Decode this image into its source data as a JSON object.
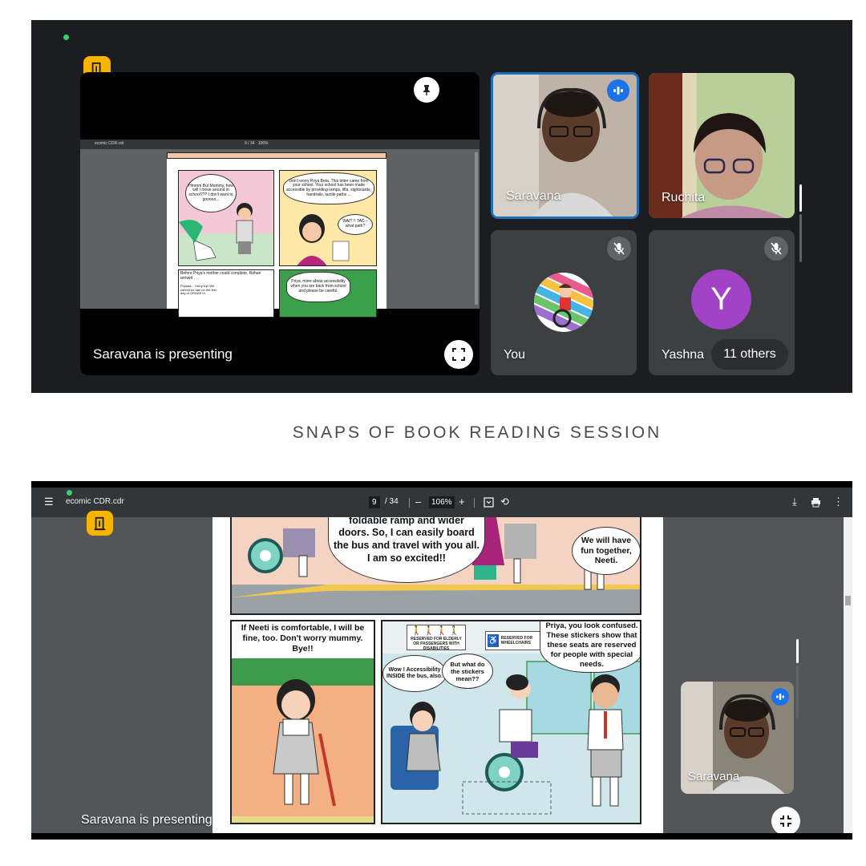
{
  "meet_top": {
    "presenting_label": "Saravana is presenting",
    "pdf_title": "ecomic CDR.cdr",
    "pdf_page": "9 / 34",
    "pdf_zoom": "106%",
    "comic_panel_1": "Hmmm But Mummy, how will I move around in school??? I don't want to gooooo...",
    "comic_panel_2": "Don't worry Priya Beta. This letter came from your school. Your school has been made accessible by providing ramps, lifts, signboards, handrails, tactile paths ...",
    "comic_panel_2_reply": "WAIT !! TAC – what path?",
    "comic_panel_2_num": "2",
    "comic_caption_3": "Before Priya's mother could complete, Rohan arrived . . .",
    "comic_caption_3b": "Priyaaa... Hurry Up! We cannot be late on the first day of GRADE III.",
    "comic_panel_4": "Priya, more about accessibility when you are back from school and please be careful.",
    "participants": [
      {
        "name": "Saravana",
        "speaking": true
      },
      {
        "name": "Ruchita",
        "speaking": false
      },
      {
        "name": "You",
        "muted": true
      },
      {
        "name": "Yashna",
        "muted": true,
        "initial": "Y"
      }
    ],
    "others_label": "11 others",
    "colors": {
      "background": "#1b1d20",
      "tile": "#3c4043",
      "accent": "#1a73e8",
      "avatar_y": "#a142c7",
      "door": "#f6b400"
    },
    "icons": [
      "door-icon",
      "pin-icon",
      "fullscreen-icon",
      "speaking-icon",
      "mic-off-icon"
    ]
  },
  "section_title": "SNAPS OF BOOK READING SESSION",
  "meet_bottom": {
    "pdf_title": "ecomic CDR.cdr",
    "page_current": "9",
    "page_total": "/ 34",
    "zoom": "106%",
    "zoom_out": "–",
    "zoom_in": "+",
    "panel_top_speech": "foldable ramp and wider doors. So, I can easily board the bus and travel with you all. I am so excited!!",
    "panel_top_reply": "We will have fun together, Neeti.",
    "panel_left_caption": "If Neeti is comfortable, I will be fine, too. Don't worry mummy. Bye!!",
    "sign_elderly": "RESERVED FOR ELDERLY OR PASSENGERS WITH DISABILITIES",
    "sign_wheelchair": "RESERVED FOR WHEELCHAIRS",
    "bubble_wow": "Wow ! Accessibility INSIDE the bus, also.",
    "bubble_question": "But what do the stickers mean??",
    "panel_right_caption": "Priya, you look confused. These stickers show that these seats are reserved for people with special needs.",
    "pip_name": "Saravana",
    "presenting_label": "Saravana is presenting",
    "icons": [
      "menu-icon",
      "fit-page-icon",
      "rotate-icon",
      "download-icon",
      "print-icon",
      "more-icon",
      "speaking-icon",
      "exit-fullscreen-icon",
      "door-icon"
    ]
  }
}
